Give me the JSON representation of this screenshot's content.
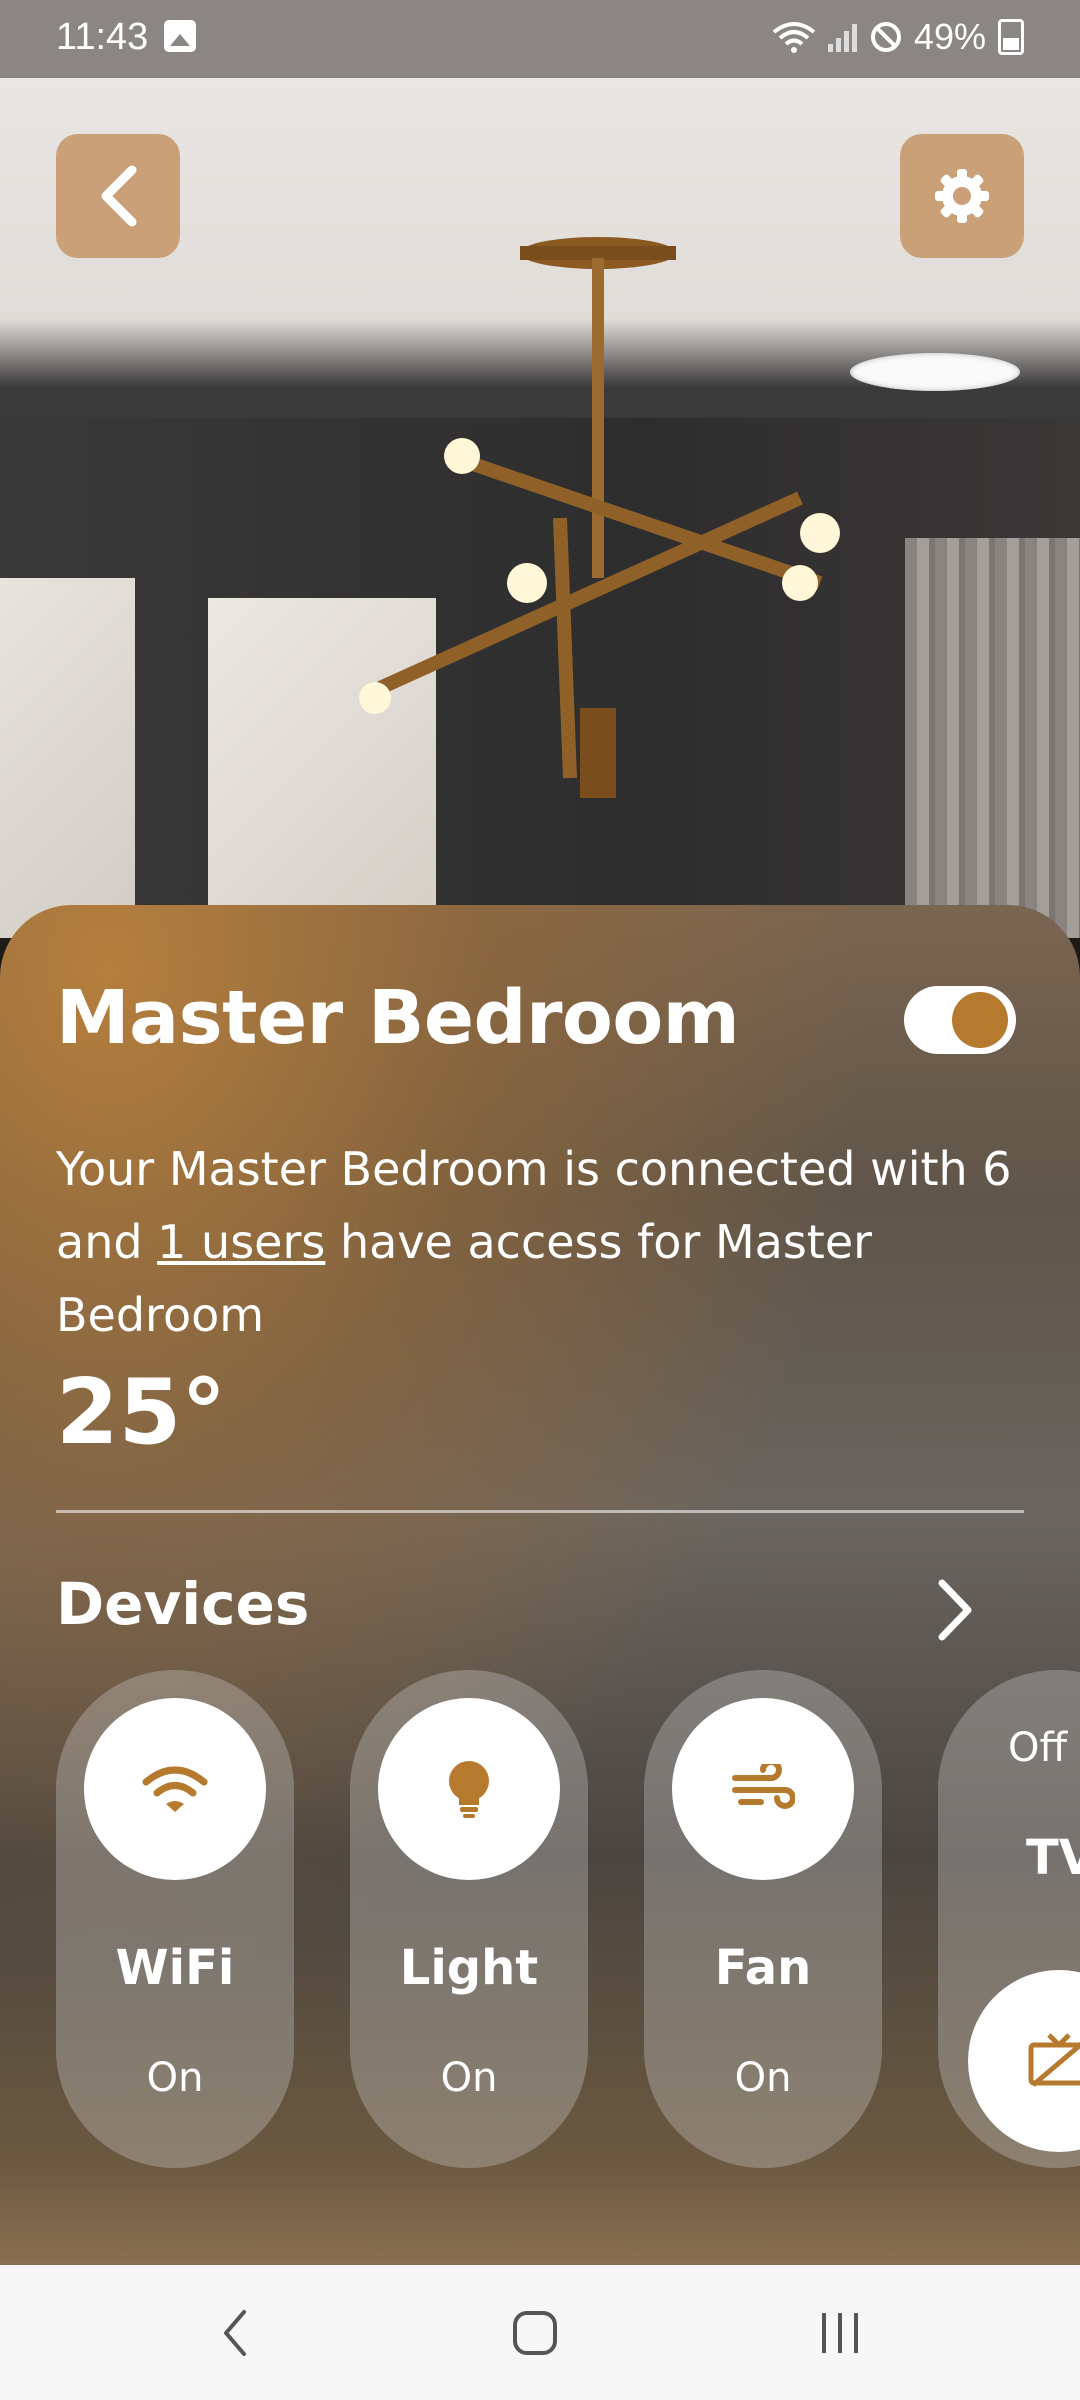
{
  "status_bar": {
    "time": "11:43",
    "battery": "49%"
  },
  "header": {
    "back_icon": "chevron-left-icon",
    "settings_icon": "gear-icon",
    "button_color": "#c9a078"
  },
  "room": {
    "title": "Master Bedroom",
    "toggle_on": true,
    "description_part1": "Your Master Bedroom is connected with 6 and ",
    "users_link": "1 users",
    "description_part2": " have access for Master Bedroom",
    "temperature": "25°"
  },
  "devices": {
    "title": "Devices",
    "items": [
      {
        "name": "WiFi",
        "state": "On",
        "icon": "wifi-icon"
      },
      {
        "name": "Light",
        "state": "On",
        "icon": "lightbulb-icon"
      },
      {
        "name": "Fan",
        "state": "On",
        "icon": "wind-icon"
      },
      {
        "name": "TV",
        "state": "Off",
        "icon": "tv-off-icon"
      }
    ]
  },
  "colors": {
    "accent": "#b67a2f",
    "nav_background": "#f7f7f7"
  }
}
